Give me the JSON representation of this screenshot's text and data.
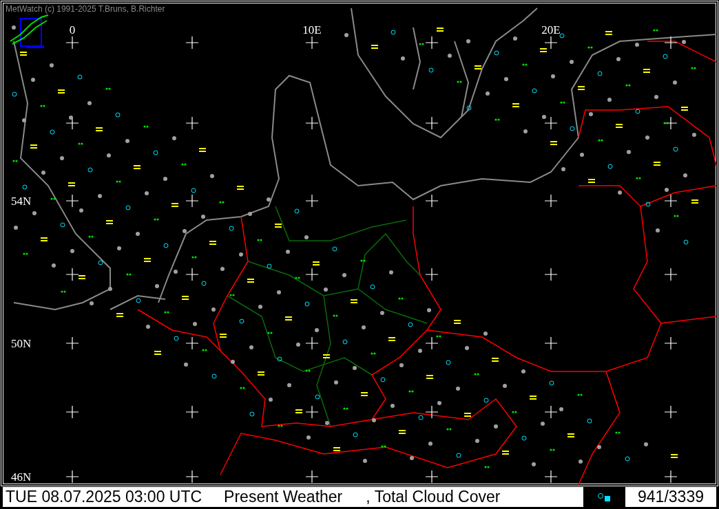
{
  "title": "MetWatch  (c) 1991-2025 T.Bruns, B.Richter",
  "longitude_labels": [
    "0",
    "10E",
    "20E"
  ],
  "latitude_labels": [
    "54N",
    "50N",
    "46N"
  ],
  "status_bar": {
    "datetime": "TUE 08.07.2025 03:00 UTC",
    "parameter": "Present Weather",
    "secondary_parameter": ", Total Cloud Cover",
    "station_count": "941/3339"
  }
}
